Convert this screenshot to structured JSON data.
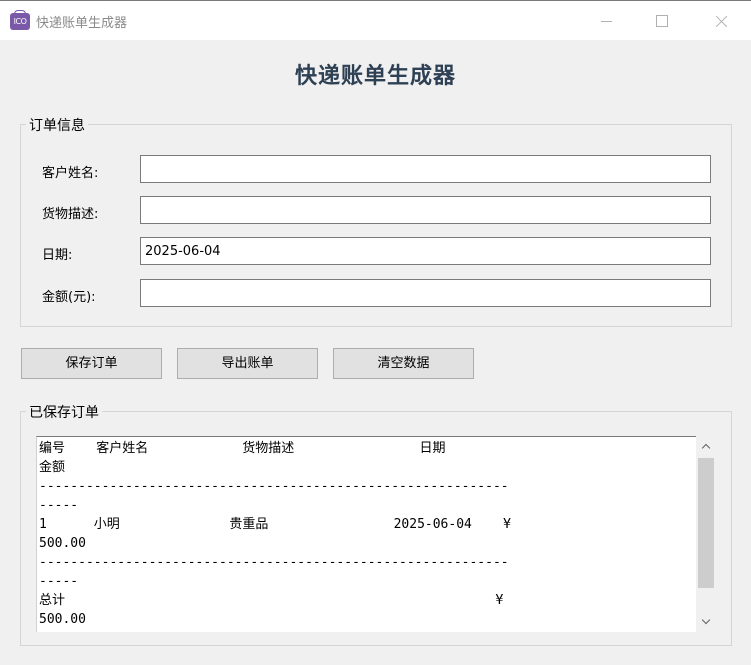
{
  "window": {
    "title": "快递账单生成器",
    "icon_text": "ICO",
    "icon": "app-icon"
  },
  "header": {
    "title": "快递账单生成器"
  },
  "order_info": {
    "legend": "订单信息",
    "fields": [
      {
        "label": "客户姓名:",
        "value": ""
      },
      {
        "label": "货物描述:",
        "value": ""
      },
      {
        "label": "日期:",
        "value": "2025-06-04"
      },
      {
        "label": "金额(元):",
        "value": ""
      }
    ]
  },
  "buttons": {
    "save": "保存订单",
    "export": "导出账单",
    "clear": "清空数据"
  },
  "saved_orders": {
    "legend": "已保存订单",
    "text": "编号    客户姓名            货物描述                日期            \n金额\n------------------------------------------------------------\n-----\n1      小明              贵重品                2025-06-04    ¥\n500.00\n------------------------------------------------------------\n-----\n总计                                                       ¥\n500.00"
  },
  "colors": {
    "title_text": "#2e4053",
    "background": "#f0f0f0",
    "button_face": "#e1e1e1"
  }
}
